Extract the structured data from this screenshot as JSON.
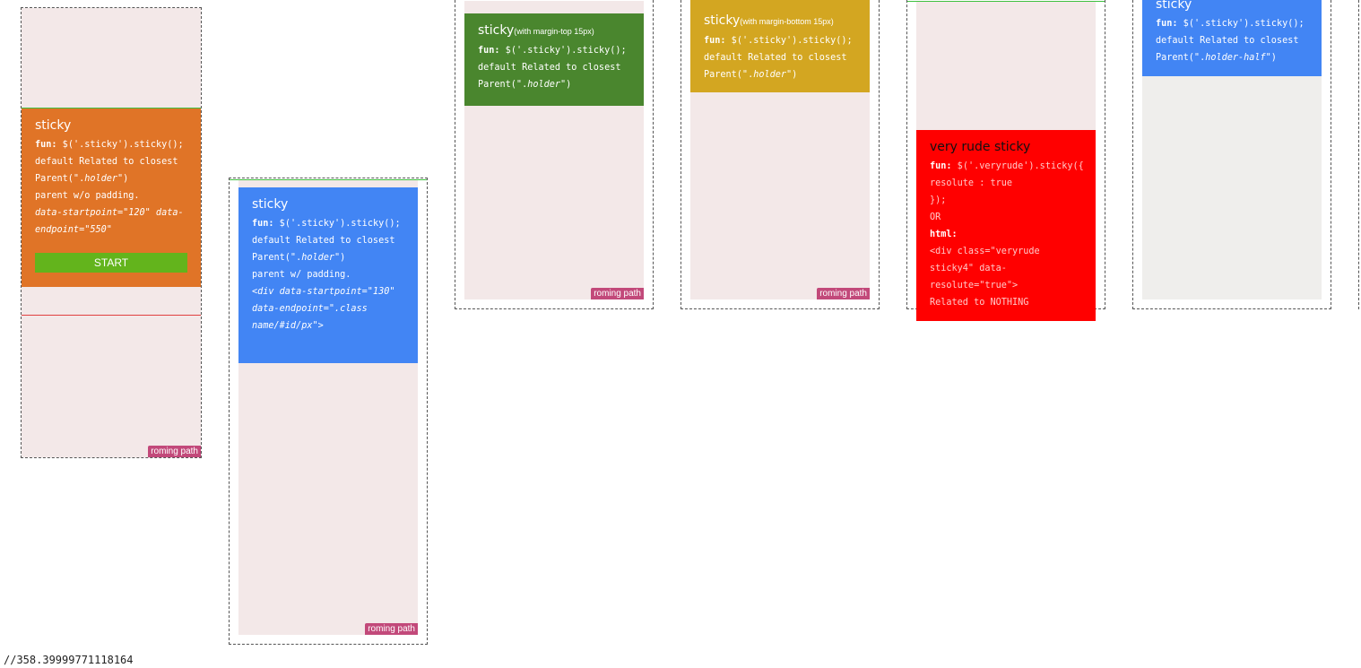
{
  "roam_label": "roming path",
  "cards": {
    "c1": {
      "title": "sticky",
      "l1_key": "fun:",
      "l1_val": " $('.sticky').sticky();",
      "l2": "default Related to closest",
      "l3_pre": "Parent(\".",
      "l3_it": "holder",
      "l3_post": "\")",
      "l4": "parent w/o padding.",
      "l5": "data-startpoint=\"120\" data-",
      "l6": "endpoint=\"550\"",
      "button": "START"
    },
    "c2": {
      "title": "sticky",
      "l1_key": "fun:",
      "l1_val": " $('.sticky').sticky();",
      "l2": "default Related to closest",
      "l3_pre": "Parent(\".",
      "l3_it": "holder",
      "l3_post": "\")",
      "l4": "parent w/ padding.",
      "l5": "<div data-startpoint=\"130\"",
      "l6": "data-endpoint=\".class",
      "l7": "name/#id/px\">"
    },
    "c3": {
      "title": "sticky",
      "sub": "(with margin-top 15px)",
      "l1_key": "fun:",
      "l1_val": " $('.sticky').sticky();",
      "l2": "default Related to closest",
      "l3_pre": "Parent(\".",
      "l3_it": "holder",
      "l3_post": "\")"
    },
    "c4": {
      "title": "sticky",
      "sub": "(with margin-bottom 15px)",
      "l1_key": "fun:",
      "l1_val": " $('.sticky').sticky();",
      "l2": "default Related to closest",
      "l3_pre": "Parent(\".",
      "l3_it": "holder",
      "l3_post": "\")"
    },
    "c5": {
      "title": "very rude sticky",
      "l1_key": "fun:",
      "l1_val": " $('.veryrude').sticky({",
      "l2": " resolute : true",
      "l3": "});",
      "l4": "OR",
      "l5": "html:",
      "l6": "<div class=\"veryrude",
      "l7": "sticky4\" data-",
      "l8": "resolute=\"true\">",
      "l9": "Related to NOTHING"
    },
    "c6": {
      "title": "sticky",
      "l1_key": "fun:",
      "l1_val": " $('.sticky').sticky();",
      "l2": "default Related to closest",
      "l3_pre": "Parent(\".",
      "l3_it": "holder-half",
      "l3_post": "\")"
    }
  },
  "footer": "//358.39999771118164",
  "colors": {
    "orange": "#e07427",
    "blue": "#4285f4",
    "green": "#4a862e",
    "gold": "#d3a621",
    "red": "#ff0000",
    "start": "#63b41c",
    "roam": "#c2497a"
  }
}
